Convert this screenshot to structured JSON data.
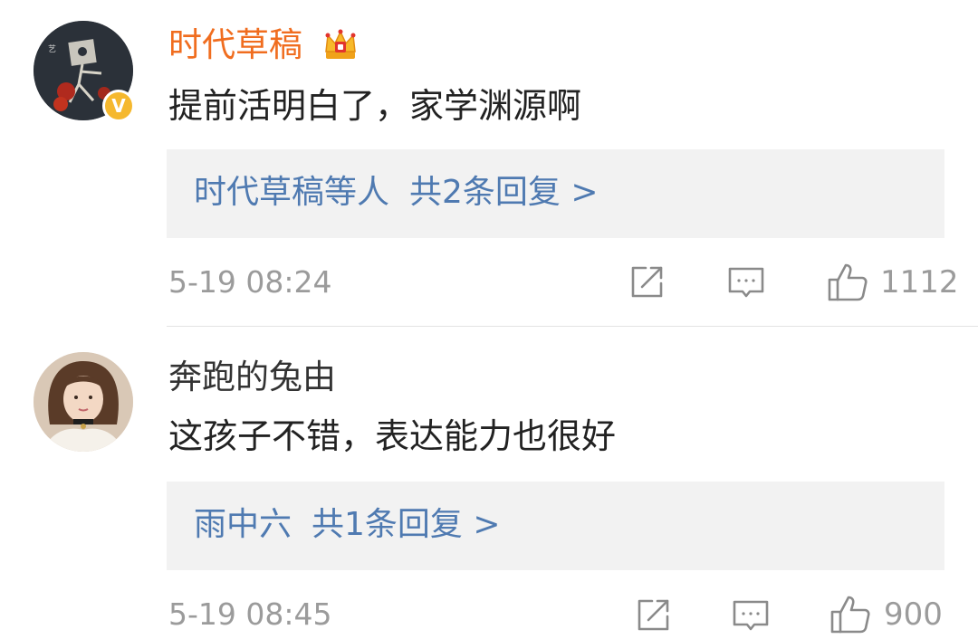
{
  "colors": {
    "vip_name": "#f06d1f",
    "reply_link": "#4f7ab1",
    "meta_gray": "#9b9b9b",
    "reply_bg": "#f2f2f2",
    "verified_badge": "#f5b82e"
  },
  "comments": [
    {
      "username": "时代草稿",
      "username_style": "vip",
      "badges": [
        "crown-icon",
        "verified-v-badge"
      ],
      "verified_mark": "V",
      "text": "提前活明白了，家学渊源啊",
      "reply_summary": {
        "names": "时代草稿等人",
        "count_text": "共2条回复 >"
      },
      "time": "5-19 08:24",
      "likes": "1112"
    },
    {
      "username": "奔跑的兔由",
      "username_style": "normal",
      "text": "这孩子不错，表达能力也很好",
      "reply_summary": {
        "names": "雨中六",
        "count_text": "共1条回复 >"
      },
      "time": "5-19 08:45",
      "likes": "900"
    }
  ]
}
